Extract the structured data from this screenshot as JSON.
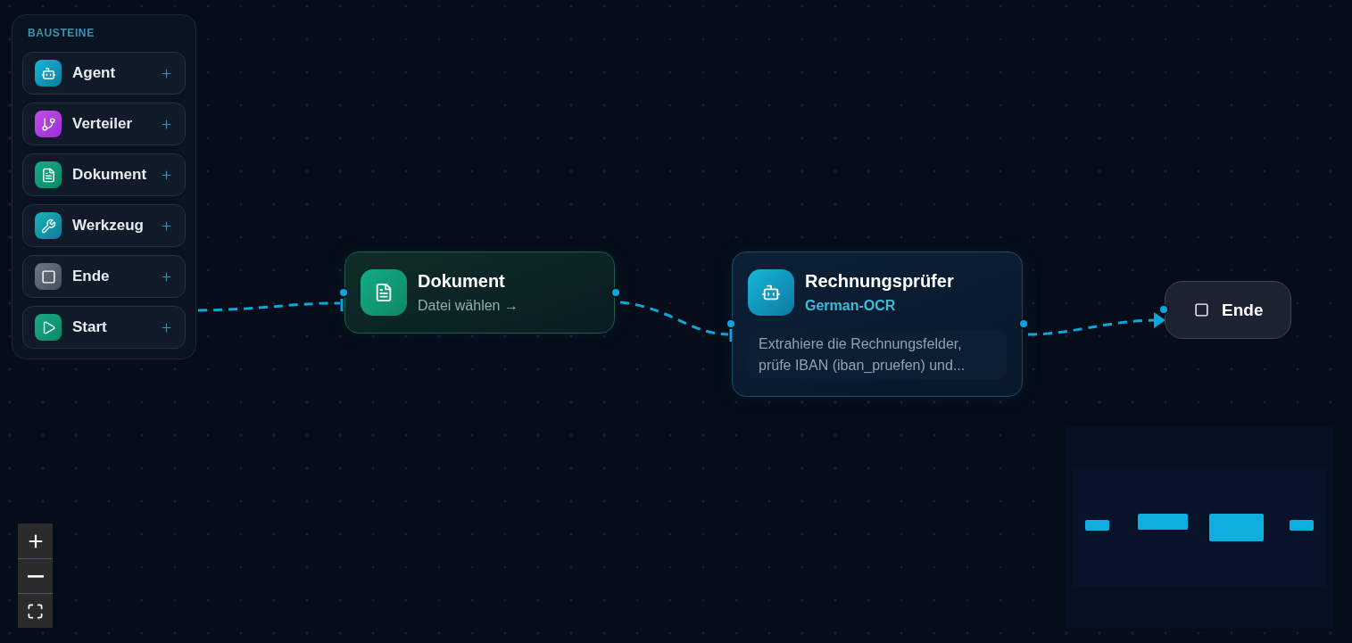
{
  "palette": {
    "title": "BAUSTEINE",
    "items": [
      {
        "kind": "agent",
        "label": "Agent"
      },
      {
        "kind": "router",
        "label": "Verteiler"
      },
      {
        "kind": "document",
        "label": "Dokument"
      },
      {
        "kind": "tool",
        "label": "Werkzeug"
      },
      {
        "kind": "end",
        "label": "Ende"
      },
      {
        "kind": "start",
        "label": "Start"
      }
    ]
  },
  "nodes": [
    {
      "kind": "document",
      "title": "Dokument",
      "subtitle": "Datei wählen →"
    },
    {
      "kind": "agent",
      "title": "Rechnungsprüfer",
      "subtitle": "German-OCR",
      "description": "Extrahiere die Rechnungsfelder, prüfe IBAN (iban_pruefen) und..."
    },
    {
      "kind": "end",
      "title": "Ende"
    }
  ]
}
